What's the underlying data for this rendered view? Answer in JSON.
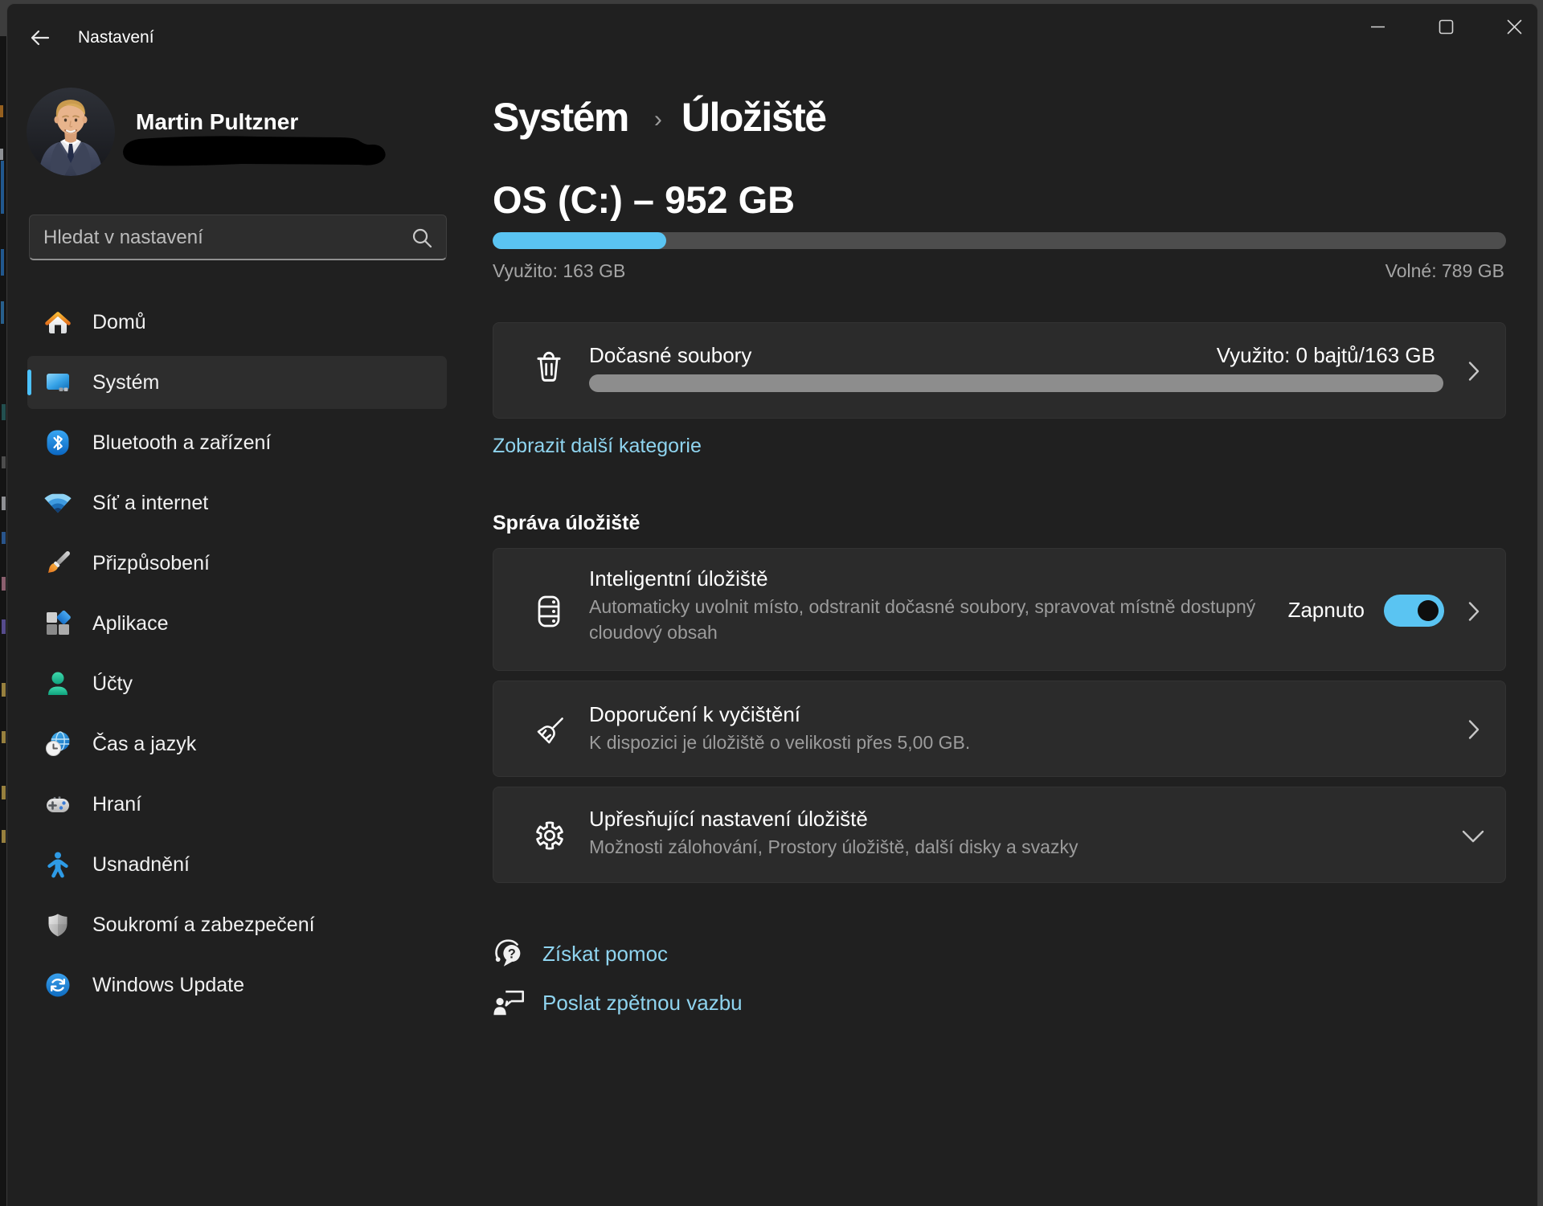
{
  "accent": "#4cc2ff",
  "titlebar": {
    "title": "Nastavení",
    "min_icon": "minimize-icon",
    "max_icon": "maximize-icon",
    "close_icon": "close-icon"
  },
  "sidebar": {
    "user": {
      "name": "Martin Pultzner",
      "email_redacted": true
    },
    "search": {
      "placeholder": "Hledat v nastavení"
    },
    "items": [
      {
        "label": "Domů",
        "icon": "home-icon",
        "selected": false
      },
      {
        "label": "Systém",
        "icon": "system-icon",
        "selected": true
      },
      {
        "label": "Bluetooth a zařízení",
        "icon": "bluetooth-icon",
        "selected": false
      },
      {
        "label": "Síť a internet",
        "icon": "network-icon",
        "selected": false
      },
      {
        "label": "Přizpůsobení",
        "icon": "personalization-icon",
        "selected": false
      },
      {
        "label": "Aplikace",
        "icon": "apps-icon",
        "selected": false
      },
      {
        "label": "Účty",
        "icon": "accounts-icon",
        "selected": false
      },
      {
        "label": "Čas a jazyk",
        "icon": "time-language-icon",
        "selected": false
      },
      {
        "label": "Hraní",
        "icon": "gaming-icon",
        "selected": false
      },
      {
        "label": "Usnadnění",
        "icon": "accessibility-icon",
        "selected": false
      },
      {
        "label": "Soukromí a zabezpečení",
        "icon": "privacy-icon",
        "selected": false
      },
      {
        "label": "Windows Update",
        "icon": "windows-update-icon",
        "selected": false
      }
    ]
  },
  "main": {
    "breadcrumb": {
      "parent": "Systém",
      "separator": "›",
      "current": "Úložiště"
    },
    "drive": {
      "title": "OS (C:) – 952 GB",
      "used_label": "Využito: 163 GB",
      "free_label": "Volné: 789 GB",
      "used_percent": 17.1
    },
    "temp_card": {
      "title": "Dočasné soubory",
      "usage": "Využito: 0 bajtů/163 GB",
      "bar_percent": 100
    },
    "show_more_link": "Zobrazit další kategorie",
    "section_title": "Správa úložiště",
    "smart_card": {
      "title": "Inteligentní úložiště",
      "description": "Automaticky uvolnit místo, odstranit dočasné soubory, spravovat místně dostupný cloudový obsah",
      "toggle_label": "Zapnuto",
      "toggle_on": true
    },
    "cleanup_card": {
      "title": "Doporučení k vyčištění",
      "description": "K dispozici je úložiště o velikosti přes 5,00 GB."
    },
    "advanced_card": {
      "title": "Upřesňující nastavení úložiště",
      "description": "Možnosti zálohování, Prostory úložiště, další disky a svazky"
    },
    "footer_links": [
      {
        "label": "Získat pomoc",
        "icon": "get-help-icon"
      },
      {
        "label": "Poslat zpětnou vazbu",
        "icon": "feedback-icon"
      }
    ]
  }
}
